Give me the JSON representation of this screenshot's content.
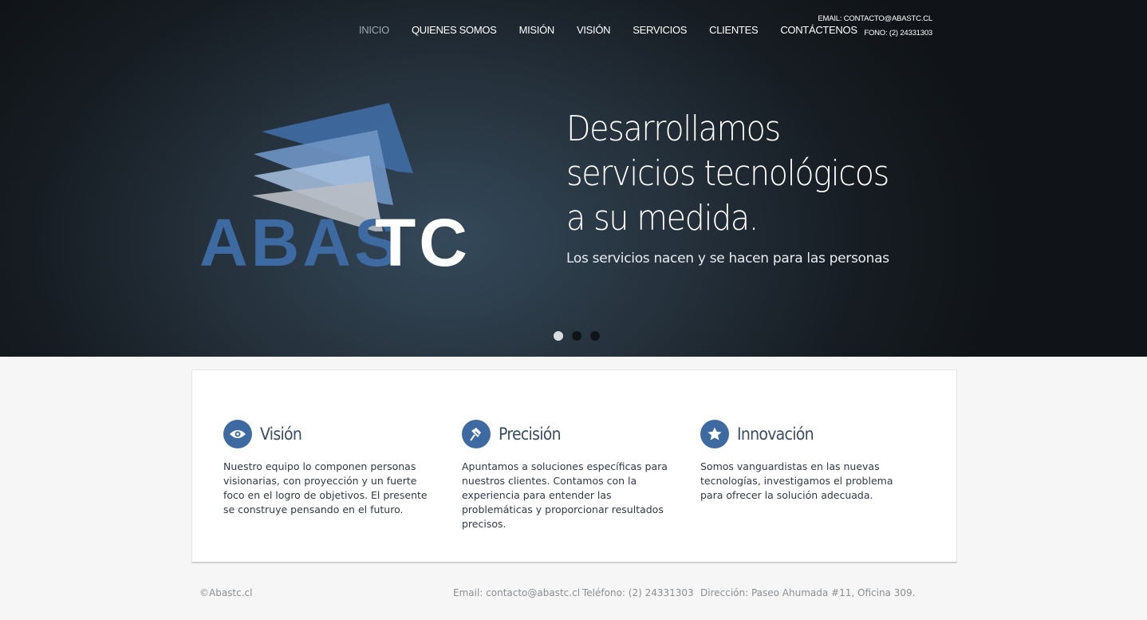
{
  "nav": {
    "items": [
      "INICIO",
      "QUIENES SOMOS",
      "MISIÓN",
      "VISIÓN",
      "SERVICIOS",
      "CLIENTES",
      "CONTÁCTENOS"
    ],
    "active_index": 0
  },
  "contact_top": {
    "email": "EMAIL: CONTACTO@ABASTC.CL",
    "phone": "FONO: (2) 24331303"
  },
  "logo": {
    "text_left": "ABAS",
    "text_right": "TC"
  },
  "hero": {
    "headline": "Desarrollamos servicios tecnológicos a su medida.",
    "subline": "Los servicios nacen y se hacen para las personas",
    "slides": 3,
    "active_slide": 0
  },
  "features": [
    {
      "icon": "eye-icon",
      "title": "Visión",
      "text": "Nuestro equipo lo componen personas visionarias, con proyección y un fuerte foco en el logro de objetivos.  El presente se construye pensando en el futuro."
    },
    {
      "icon": "pin-icon",
      "title": "Precisión",
      "text": "Apuntamos a soluciones específicas para nuestros clientes. Contamos con la experiencia para entender las problemáticas y proporcionar resultados precisos."
    },
    {
      "icon": "star-icon",
      "title": "Innovación",
      "text": "Somos vanguardistas en las nuevas tecnologías, investigamos el problema para ofrecer la solución adecuada."
    }
  ],
  "footer": {
    "copyright": "©Abastc.cl",
    "email": "Email: contacto@abastc.cl",
    "phone": "Teléfono: (2) 24331303",
    "address": "Dirección: Paseo Ahumada #11, Oficina 309."
  },
  "colors": {
    "brand_blue": "#3d6aa1",
    "hero_dark": "#161c22"
  }
}
